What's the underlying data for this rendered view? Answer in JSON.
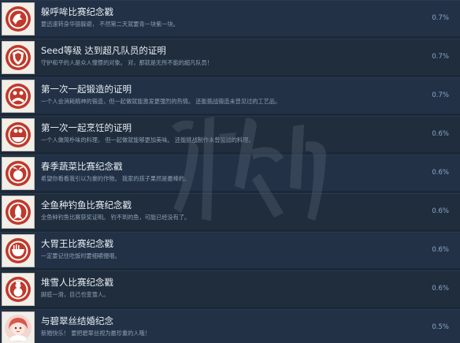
{
  "achievements": [
    {
      "title": "躲呼哞比赛纪念戳",
      "description": "要迅速转身华丽躲避，  不然第二天就要青一块紫一块。",
      "percent": "0.7%",
      "icon": "dodge-icon",
      "accent": "#c0392b"
    },
    {
      "title": "Seed等级 达到超凡队员的证明",
      "description": "守护和平的人是众人憧憬的对象。  对，那就是无所不能的超凡队员！",
      "percent": "0.7%",
      "icon": "shield-badge-icon",
      "accent": "#c0392b"
    },
    {
      "title": "第一次一起锻造的证明",
      "description": "一个人会消耗精神的锻造，但一起做就能激发更强烈的热情。  还能挑战锻造未曾见过的工艺品。",
      "percent": "0.7%",
      "icon": "forge-icon",
      "accent": "#c0392b"
    },
    {
      "title": "第一次一起烹饪的证明",
      "description": "一个人做简朴味的料理，  但一起做就能够更加美味。  还能挑战制作未曾见过的料理。",
      "percent": "0.6%",
      "icon": "cooking-icon",
      "accent": "#c0392b"
    },
    {
      "title": "春季蔬菜比赛纪念戳",
      "description": "希望你看看我引以为豪的作物。  我家的孩子果然是最棒的。",
      "percent": "0.6%",
      "icon": "vegetable-icon",
      "accent": "#c0392b"
    },
    {
      "title": "全鱼种钓鱼比赛纪念戳",
      "description": "全鱼种钓鱼比赛获奖证明。  钓不到的鱼，可能已经没有了。",
      "percent": "0.6%",
      "icon": "fish-icon",
      "accent": "#c0392b"
    },
    {
      "title": "大胃王比赛纪念戳",
      "description": "一定要记住吃饭时要细嚼慢咽。",
      "percent": "0.6%",
      "icon": "bowl-icon",
      "accent": "#c0392b"
    },
    {
      "title": "堆雪人比赛纪念戳",
      "description": "脚底一滑，自己也变雪人。",
      "percent": "0.6%",
      "icon": "snowman-icon",
      "accent": "#c0392b"
    },
    {
      "title": "与碧翠丝结婚纪念",
      "description": "新婚快乐！  要把碧翠丝视为最珍重的人哦！",
      "percent": "0.5%",
      "icon": "bride-portrait-icon",
      "accent": "#c0392b"
    }
  ]
}
